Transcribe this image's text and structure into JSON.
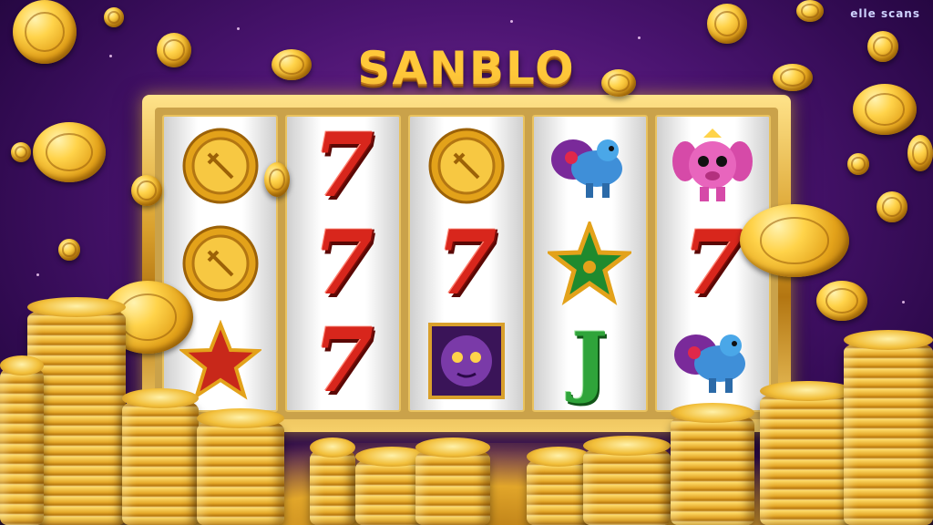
{
  "watermark": "elle scans",
  "game": {
    "title": "SANBLO"
  },
  "reels": [
    [
      {
        "symbol": "gold-coin"
      },
      {
        "symbol": "gold-coin"
      },
      {
        "symbol": "red-star"
      }
    ],
    [
      {
        "symbol": "seven",
        "text": "7"
      },
      {
        "symbol": "seven",
        "text": "7"
      },
      {
        "symbol": "seven",
        "text": "7"
      }
    ],
    [
      {
        "symbol": "gold-coin"
      },
      {
        "symbol": "seven",
        "text": "7"
      },
      {
        "symbol": "purple-creature"
      }
    ],
    [
      {
        "symbol": "peacock-creature"
      },
      {
        "symbol": "green-star"
      },
      {
        "symbol": "jack",
        "text": "J"
      }
    ],
    [
      {
        "symbol": "pink-creature"
      },
      {
        "symbol": "seven",
        "text": "7"
      },
      {
        "symbol": "peacock-creature"
      }
    ]
  ],
  "colors": {
    "background": "#4a1470",
    "frame_gold": "#d9a02c",
    "seven_red": "#d8261c",
    "jack_green": "#2fa43a"
  }
}
